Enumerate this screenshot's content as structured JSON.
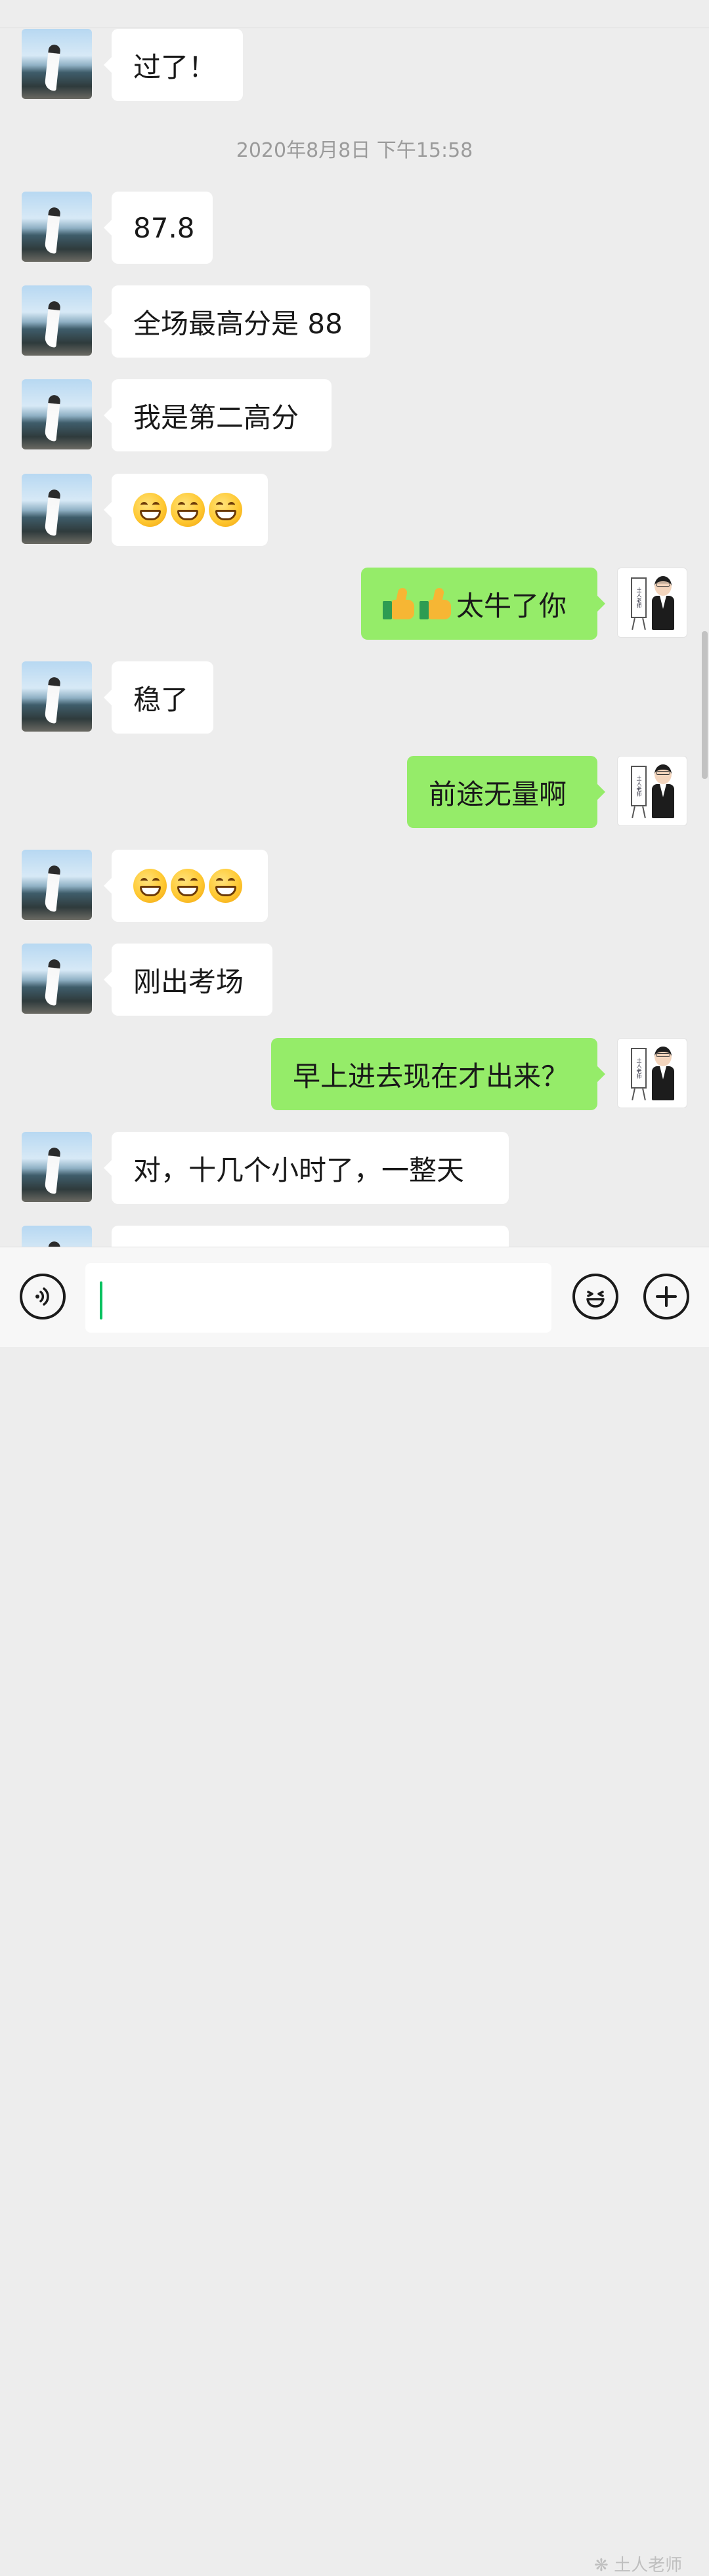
{
  "timestamp": "2020年8月8日 下午15:58",
  "messages": [
    {
      "side": "in",
      "text": "过了！"
    },
    {
      "side": "in",
      "text": "87.8"
    },
    {
      "side": "in",
      "text": "全场最高分是 88"
    },
    {
      "side": "in",
      "text": "我是第二高分"
    },
    {
      "side": "in",
      "emoji": "grinning-face",
      "emoji_count": 3
    },
    {
      "side": "out",
      "emoji": "thumbs-up",
      "emoji_count": 2,
      "text": "太牛了你"
    },
    {
      "side": "in",
      "text": "稳了"
    },
    {
      "side": "out",
      "text": "前途无量啊"
    },
    {
      "side": "in",
      "emoji": "grinning-face",
      "emoji_count": 3
    },
    {
      "side": "in",
      "text": "刚出考场"
    },
    {
      "side": "out",
      "text": "早上进去现在才出来？"
    },
    {
      "side": "in",
      "text": "对，十几个小时了，一整天"
    }
  ],
  "teacher_avatar_board_text": "土人老师",
  "input": {
    "value": ""
  },
  "icons": {
    "voice": "voice-icon",
    "emoji": "emoji-icon",
    "plus": "plus-icon"
  },
  "watermark": "土人老师",
  "colors": {
    "incoming_bubble": "#ffffff",
    "outgoing_bubble": "#95ec69",
    "background": "#ededed",
    "caret": "#07c160"
  }
}
